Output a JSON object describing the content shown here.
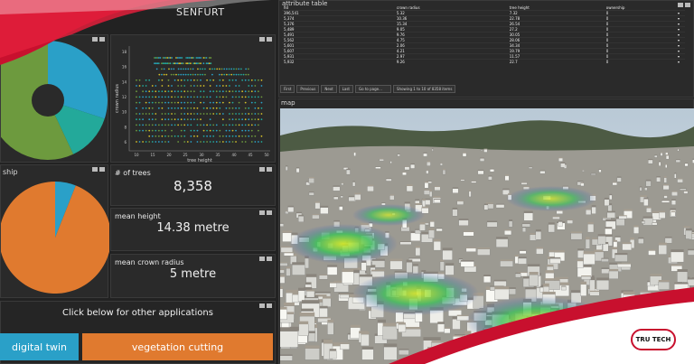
{
  "header": {
    "title_fragment": "SENFURT"
  },
  "charts": {
    "donut_top": {
      "slices": [
        {
          "color": "#2aa0c8",
          "fraction": 0.3
        },
        {
          "color": "#23a99a",
          "fraction": 0.13
        },
        {
          "color": "#6d9a3e",
          "fraction": 0.57
        }
      ]
    },
    "scatter": {
      "xlabel": "tree height",
      "ylabel": "crown radius",
      "x_ticks": [
        "10",
        "15",
        "20",
        "25",
        "30",
        "35",
        "40",
        "45",
        "50"
      ],
      "y_ticks": [
        "6",
        "8",
        "10",
        "12",
        "14",
        "16",
        "18"
      ]
    },
    "ownership_pie": {
      "label_fragment": "ship",
      "slices": [
        {
          "color": "#2aa0c8",
          "fraction": 0.06
        },
        {
          "color": "#e07a2f",
          "fraction": 0.94
        }
      ]
    }
  },
  "stats": {
    "trees": {
      "label": "# of trees",
      "value": "8,358"
    },
    "height": {
      "label": "mean height",
      "value": "14.38 metre"
    },
    "crown": {
      "label": "mean crown radius",
      "value": "5 metre"
    }
  },
  "apps": {
    "prompt": "Click below for other applications",
    "digital_twin": "digital twin",
    "vegetation": "vegetation cutting"
  },
  "attribute_table": {
    "title": "attribute table",
    "columns": [
      "fid",
      "crown radius",
      "tree height",
      "ownership"
    ],
    "rows": [
      [
        "396,541",
        "5.32",
        "7.32",
        "0"
      ],
      [
        "5,374",
        "10.36",
        "22.78",
        "0"
      ],
      [
        "5,376",
        "15.34",
        "26.54",
        "0"
      ],
      [
        "5,489",
        "9.05",
        "27.2",
        "0"
      ],
      [
        "5,491",
        "9.76",
        "30.05",
        "0"
      ],
      [
        "5,562",
        "4.75",
        "28.06",
        "0"
      ],
      [
        "5,601",
        "2.06",
        "34.34",
        "0"
      ],
      [
        "5,607",
        "4.21",
        "19.79",
        "0"
      ],
      [
        "5,931",
        "2.97",
        "11.57",
        "0"
      ],
      [
        "5,932",
        "9.26",
        "22.7",
        "0"
      ]
    ],
    "pager": {
      "first": "First",
      "previous": "Previous",
      "next": "Next",
      "last": "Last",
      "goto_placeholder": "Go to page...",
      "status": "Showing 1 to 10 of 8358 items"
    }
  },
  "map": {
    "title": "map"
  },
  "logo": {
    "text": "TRU TECH"
  }
}
